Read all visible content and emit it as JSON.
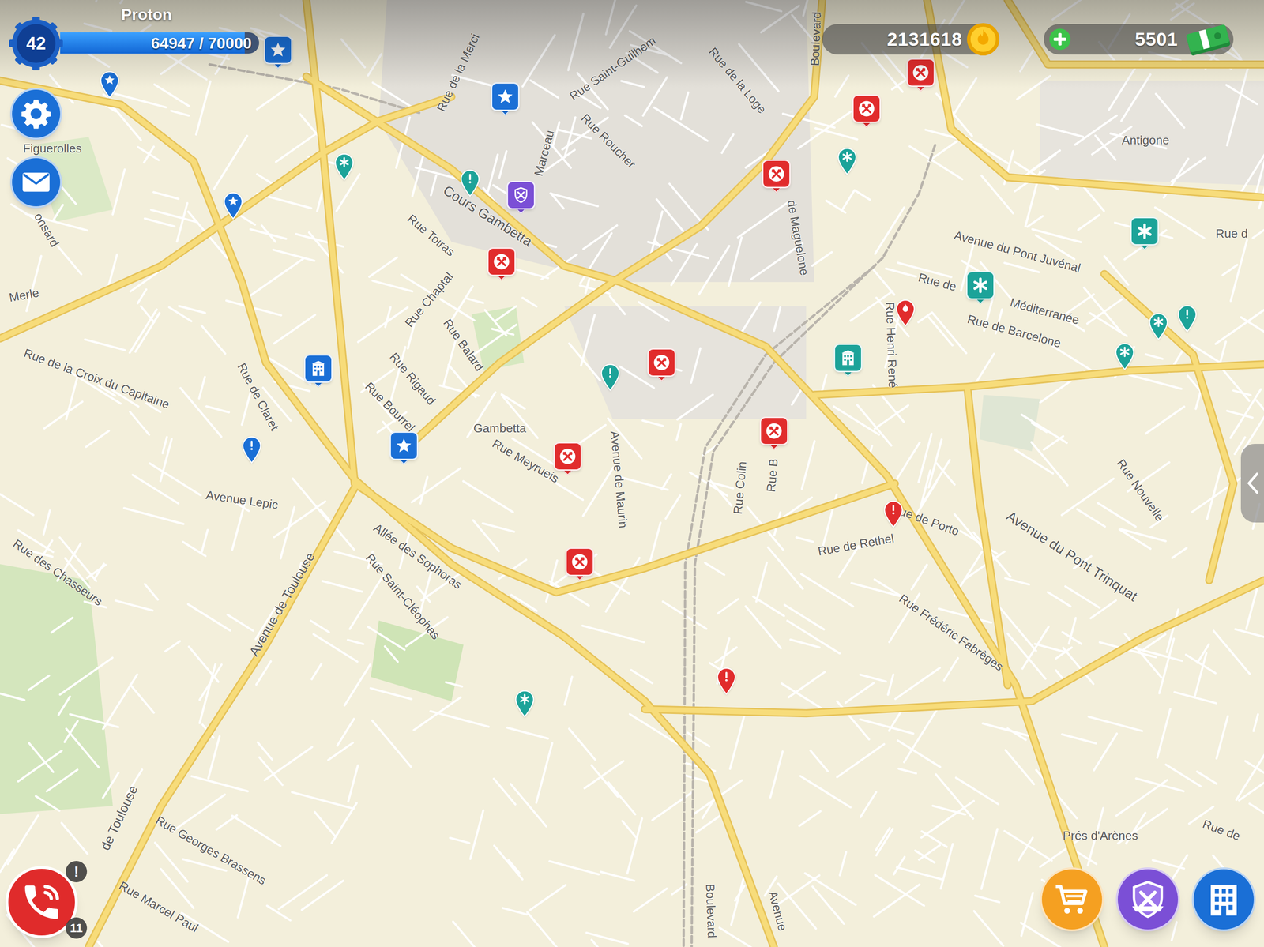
{
  "player": {
    "name": "Proton",
    "level": "42",
    "xp": "64947 / 70000",
    "xp_level": 0.928
  },
  "currency": {
    "coins": "2131618",
    "cash": "5501"
  },
  "phone": {
    "alert": "!",
    "count": "11"
  },
  "map": {
    "labels": [
      {
        "text": "Rue de la Merci"
      },
      {
        "text": "Rue Saint-Guilhem"
      },
      {
        "text": "Rue de la Loge"
      },
      {
        "text": "Rue Roucher"
      },
      {
        "text": "Marceau"
      },
      {
        "text": "Cours Gambetta"
      },
      {
        "text": "Rue Toiras"
      },
      {
        "text": "Rue Chaptal"
      },
      {
        "text": "Rue Balard"
      },
      {
        "text": "Rue Rigaud"
      },
      {
        "text": "Rue Bourrel"
      },
      {
        "text": "Figuerolles"
      },
      {
        "text": "Merle"
      },
      {
        "text": "onsard"
      },
      {
        "text": "Rue de la Croix du Capitaine"
      },
      {
        "text": "Rue de Claret"
      },
      {
        "text": "Avenue Lepic"
      },
      {
        "text": "Rue des Chasseurs"
      },
      {
        "text": "Avenue de Toulouse"
      },
      {
        "text": "de Toulouse"
      },
      {
        "text": "Allée des Sophoras"
      },
      {
        "text": "Rue Saint-Cléophas"
      },
      {
        "text": "Gambetta"
      },
      {
        "text": "Rue Meyrueis"
      },
      {
        "text": "Avenue de Maurin"
      },
      {
        "text": "Rue Colin"
      },
      {
        "text": "Rue B"
      },
      {
        "text": "de Maguelone"
      },
      {
        "text": "Rue Henri René"
      },
      {
        "text": "Avenue du Pont Juvénal"
      },
      {
        "text": "Rue de"
      },
      {
        "text": "Méditerranée"
      },
      {
        "text": "Rue de Barcelone"
      },
      {
        "text": "Antigone"
      },
      {
        "text": "Rue d"
      },
      {
        "text": "Rue de Porto"
      },
      {
        "text": "Rue de Rethel"
      },
      {
        "text": "Rue Frédéric Fabrèges"
      },
      {
        "text": "Avenue du Pont Trinquat"
      },
      {
        "text": "Rue Nouvelle"
      },
      {
        "text": "Rue Georges Brassens"
      },
      {
        "text": "Rue Marcel Paul"
      },
      {
        "text": "Prés d'Arènes"
      },
      {
        "text": "Boulevard"
      },
      {
        "text": "Boulevard"
      },
      {
        "text": "Avenue"
      },
      {
        "text": "Rue de"
      }
    ],
    "pins": [
      {
        "kind": "police-station",
        "color": "#1a6fd6"
      },
      {
        "kind": "police-station",
        "color": "#1a6fd6"
      },
      {
        "kind": "guild",
        "color": "#7b4fd6"
      },
      {
        "kind": "fire-station",
        "color": "#e12c2c"
      },
      {
        "kind": "police-building",
        "color": "#1a6fd6"
      },
      {
        "kind": "police-station",
        "color": "#1a6fd6"
      },
      {
        "kind": "fire-station",
        "color": "#e12c2c"
      },
      {
        "kind": "fire-station",
        "color": "#e12c2c"
      },
      {
        "kind": "fire-station",
        "color": "#e12c2c"
      },
      {
        "kind": "fire-station",
        "color": "#e12c2c"
      },
      {
        "kind": "fire-station",
        "color": "#e12c2c"
      },
      {
        "kind": "fire-station",
        "color": "#e12c2c"
      },
      {
        "kind": "fire-station",
        "color": "#e12c2c"
      },
      {
        "kind": "hospital",
        "color": "#1ca399"
      },
      {
        "kind": "hospital",
        "color": "#1ca399"
      },
      {
        "kind": "hospital-building",
        "color": "#1ca399"
      },
      {
        "kind": "police-poi",
        "color": "#1a6fd6"
      },
      {
        "kind": "police-poi",
        "color": "#1a6fd6"
      },
      {
        "kind": "medical-poi",
        "color": "#1ca399"
      },
      {
        "kind": "alert",
        "color": "#1ca399"
      },
      {
        "kind": "medical-poi",
        "color": "#1ca399"
      },
      {
        "kind": "alert",
        "color": "#1ca399"
      },
      {
        "kind": "alert",
        "color": "#1a6fd6"
      },
      {
        "kind": "fire",
        "color": "#e12c2c"
      },
      {
        "kind": "alert",
        "color": "#e12c2c"
      },
      {
        "kind": "alert",
        "color": "#e12c2c"
      },
      {
        "kind": "medical-poi",
        "color": "#1ca399"
      },
      {
        "kind": "medical-poi",
        "color": "#1ca399"
      },
      {
        "kind": "alert",
        "color": "#1ca399"
      },
      {
        "kind": "medical-poi",
        "color": "#1ca399"
      }
    ]
  }
}
